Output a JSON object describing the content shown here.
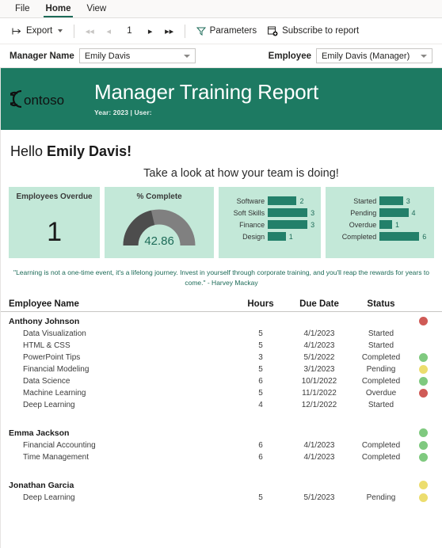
{
  "ribbon": {
    "tabs": [
      {
        "label": "File",
        "active": false
      },
      {
        "label": "Home",
        "active": true
      },
      {
        "label": "View",
        "active": false
      }
    ]
  },
  "toolbar": {
    "export_label": "Export",
    "export_icon": "export-arrow-icon",
    "first_page_icon": "first-page-icon",
    "prev_page_icon": "previous-page-icon",
    "page_number": "1",
    "next_page_icon": "next-page-icon",
    "last_page_icon": "last-page-icon",
    "parameters_label": "Parameters",
    "parameters_icon": "filter-funnel-icon",
    "subscribe_label": "Subscribe to report",
    "subscribe_icon": "subscribe-icon"
  },
  "parameters": {
    "manager": {
      "label": "Manager Name",
      "value": "Emily Davis",
      "caret_icon": "chevron-down-icon"
    },
    "employee": {
      "label": "Employee",
      "value": "Emily Davis (Manager)",
      "caret_icon": "chevron-down-icon"
    }
  },
  "banner": {
    "logo_text": "Contoso",
    "logo_icon": "contoso-logo-icon",
    "title": "Manager Training Report",
    "subtitle": "Year: 2023 | User:",
    "background_color": "#1d7a62"
  },
  "body": {
    "greeting_prefix": "Hello ",
    "greeting_name": "Emily Davis!",
    "tagline": "Take a look at how your team is doing!",
    "quote": "\"Learning is not a one-time event, it's a lifelong journey. Invest in yourself through corporate training, and you'll reap the rewards for years to come.\" - Harvey Mackay"
  },
  "cards": {
    "overdue": {
      "title": "Employees Overdue",
      "value": "1"
    },
    "gauge": {
      "title": "% Complete",
      "value": "42.86",
      "fill_color": "#4d4d4d",
      "track_color": "#808080"
    }
  },
  "chart_data": [
    {
      "type": "bar",
      "title": "",
      "orientation": "horizontal",
      "categories": [
        "Software",
        "Soft Skills",
        "Finance",
        "Design"
      ],
      "values": [
        2,
        3,
        3,
        1
      ],
      "bar_color": "#23806a",
      "xlabel": "",
      "ylabel": "",
      "grid": false,
      "legend": "none"
    },
    {
      "type": "bar",
      "title": "",
      "orientation": "horizontal",
      "categories": [
        "Started",
        "Pending",
        "Overdue",
        "Completed"
      ],
      "values": [
        3,
        4,
        1,
        6
      ],
      "bar_color": "#23806a",
      "xlabel": "",
      "ylabel": "",
      "grid": false,
      "legend": "none"
    },
    {
      "type": "gauge",
      "title": "% Complete",
      "value": 42.86,
      "min": 0,
      "max": 100,
      "fill_color": "#4d4d4d",
      "track_color": "#808080"
    }
  ],
  "table": {
    "headers": {
      "name": "Employee Name",
      "hours": "Hours",
      "due": "Due Date",
      "status": "Status"
    },
    "groups": [
      {
        "name": "Anthony Johnson",
        "dot": "#cf5a56",
        "rows": [
          {
            "name": "Data Visualization",
            "hours": "5",
            "due": "4/1/2023",
            "status": "Started",
            "dot": ""
          },
          {
            "name": "HTML & CSS",
            "hours": "5",
            "due": "4/1/2023",
            "status": "Started",
            "dot": ""
          },
          {
            "name": "PowerPoint Tips",
            "hours": "3",
            "due": "5/1/2022",
            "status": "Completed",
            "dot": "#7fc97f"
          },
          {
            "name": "Financial Modeling",
            "hours": "5",
            "due": "3/1/2023",
            "status": "Pending",
            "dot": "#ecdd6e"
          },
          {
            "name": "Data Science",
            "hours": "6",
            "due": "10/1/2022",
            "status": "Completed",
            "dot": "#7fc97f"
          },
          {
            "name": "Machine Learning",
            "hours": "5",
            "due": "11/1/2022",
            "status": "Overdue",
            "dot": "#cf5a56"
          },
          {
            "name": "Deep Learning",
            "hours": "4",
            "due": "12/1/2022",
            "status": "Started",
            "dot": ""
          }
        ]
      },
      {
        "name": "Emma Jackson",
        "dot": "#7fc97f",
        "rows": [
          {
            "name": "Financial Accounting",
            "hours": "6",
            "due": "4/1/2023",
            "status": "Completed",
            "dot": "#7fc97f"
          },
          {
            "name": "Time Management",
            "hours": "6",
            "due": "4/1/2023",
            "status": "Completed",
            "dot": "#7fc97f"
          }
        ]
      },
      {
        "name": "Jonathan Garcia",
        "dot": "#ecdd6e",
        "rows": [
          {
            "name": "Deep Learning",
            "hours": "5",
            "due": "5/1/2023",
            "status": "Pending",
            "dot": "#ecdd6e"
          }
        ]
      }
    ]
  }
}
